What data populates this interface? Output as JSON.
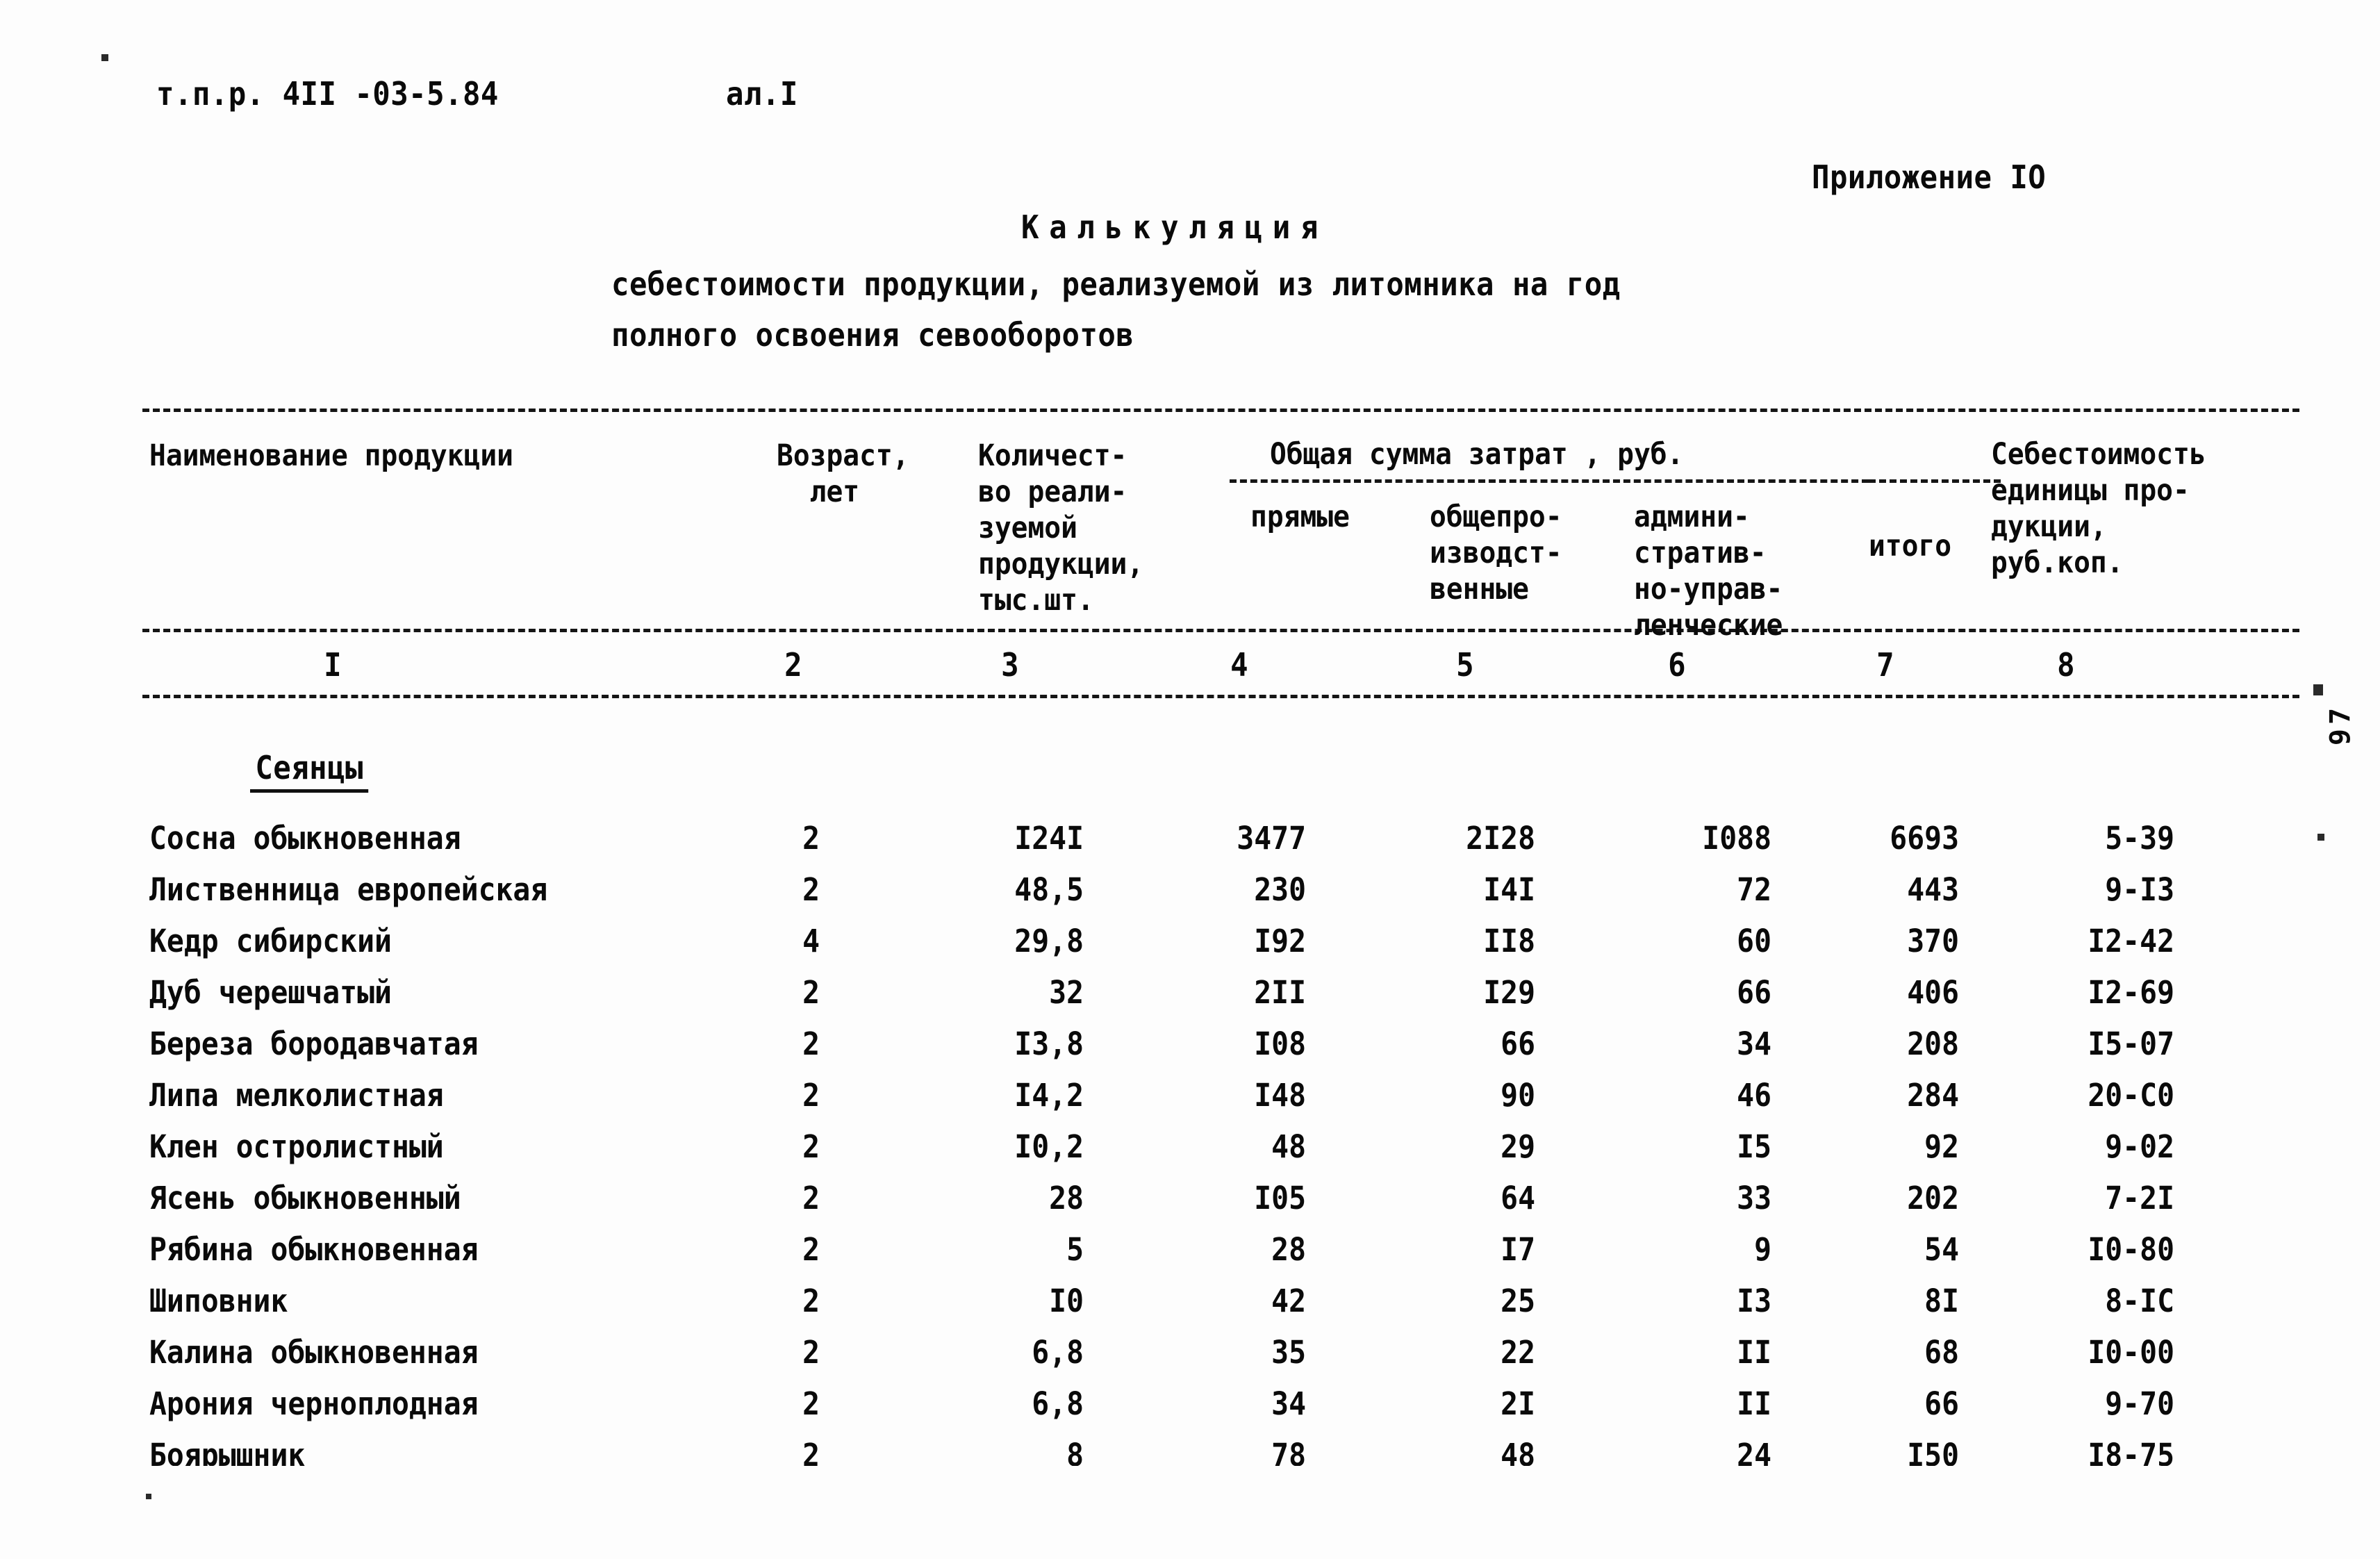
{
  "header": {
    "doc_code": "т.п.р. 4II -03-5.84",
    "sheet_label": "ал.I",
    "appendix": "Приложение IO"
  },
  "title": {
    "main": "Калькуляция",
    "sub_line1": "себестоимости продукции, реализуемой из литомника на год",
    "sub_line2": "полного освоения севооборотов"
  },
  "table": {
    "headers": {
      "name": "Наименование продукции",
      "age": "Возраст,\n  лет",
      "quantity": "Количест-\nво реали-\nзуемой\nпродукции,\nтыс.шт.",
      "costs_group": "Общая сумма затрат , руб.",
      "direct": "прямые",
      "general": "общепро-\nизводст-\nвенные",
      "admin": "админи-\nстратив-\nно-управ-\nленческие",
      "total": "итого",
      "unit_cost": "Себестоимость\nединицы про-\nдукции,\nруб.коп."
    },
    "column_numbers": [
      "I",
      "2",
      "3",
      "4",
      "5",
      "6",
      "7",
      "8"
    ],
    "section_label": "Сеянцы",
    "rows": [
      {
        "name": "Сосна обыкновенная",
        "age": "2",
        "qty": "I24I",
        "direct": "3477",
        "general": "2I28",
        "admin": "I088",
        "total": "6693",
        "unit_cost": "5-39"
      },
      {
        "name": "Лиственница европейская",
        "age": "2",
        "qty": "48,5",
        "direct": "230",
        "general": "I4I",
        "admin": "72",
        "total": "443",
        "unit_cost": "9-I3"
      },
      {
        "name": "Кедр сибирский",
        "age": "4",
        "qty": "29,8",
        "direct": "I92",
        "general": "II8",
        "admin": "60",
        "total": "370",
        "unit_cost": "I2-42"
      },
      {
        "name": "Дуб черешчатый",
        "age": "2",
        "qty": "32",
        "direct": "2II",
        "general": "I29",
        "admin": "66",
        "total": "406",
        "unit_cost": "I2-69"
      },
      {
        "name": "Береза бородавчатая",
        "age": "2",
        "qty": "I3,8",
        "direct": "I08",
        "general": "66",
        "admin": "34",
        "total": "208",
        "unit_cost": "I5-07"
      },
      {
        "name": "Липа мелколистная",
        "age": "2",
        "qty": "I4,2",
        "direct": "I48",
        "general": "90",
        "admin": "46",
        "total": "284",
        "unit_cost": "20-C0"
      },
      {
        "name": "Клен остролистный",
        "age": "2",
        "qty": "I0,2",
        "direct": "48",
        "general": "29",
        "admin": "I5",
        "total": "92",
        "unit_cost": "9-02"
      },
      {
        "name": "Ясень обыкновенный",
        "age": "2",
        "qty": "28",
        "direct": "I05",
        "general": "64",
        "admin": "33",
        "total": "202",
        "unit_cost": "7-2I"
      },
      {
        "name": "Рябина обыкновенная",
        "age": "2",
        "qty": "5",
        "direct": "28",
        "general": "I7",
        "admin": "9",
        "total": "54",
        "unit_cost": "I0-80"
      },
      {
        "name": "Шиповник",
        "age": "2",
        "qty": "I0",
        "direct": "42",
        "general": "25",
        "admin": "I3",
        "total": "8I",
        "unit_cost": "8-IC"
      },
      {
        "name": "Калина обыкновенная",
        "age": "2",
        "qty": "6,8",
        "direct": "35",
        "general": "22",
        "admin": "II",
        "total": "68",
        "unit_cost": "I0-00"
      },
      {
        "name": "Арония черноплодная",
        "age": "2",
        "qty": "6,8",
        "direct": "34",
        "general": "2I",
        "admin": "II",
        "total": "66",
        "unit_cost": "9-70"
      },
      {
        "name": "Боярышник",
        "age": "2",
        "qty": "8",
        "direct": "78",
        "general": "48",
        "admin": "24",
        "total": "I50",
        "unit_cost": "I8-75"
      }
    ]
  },
  "margin": {
    "page_number": "97"
  }
}
